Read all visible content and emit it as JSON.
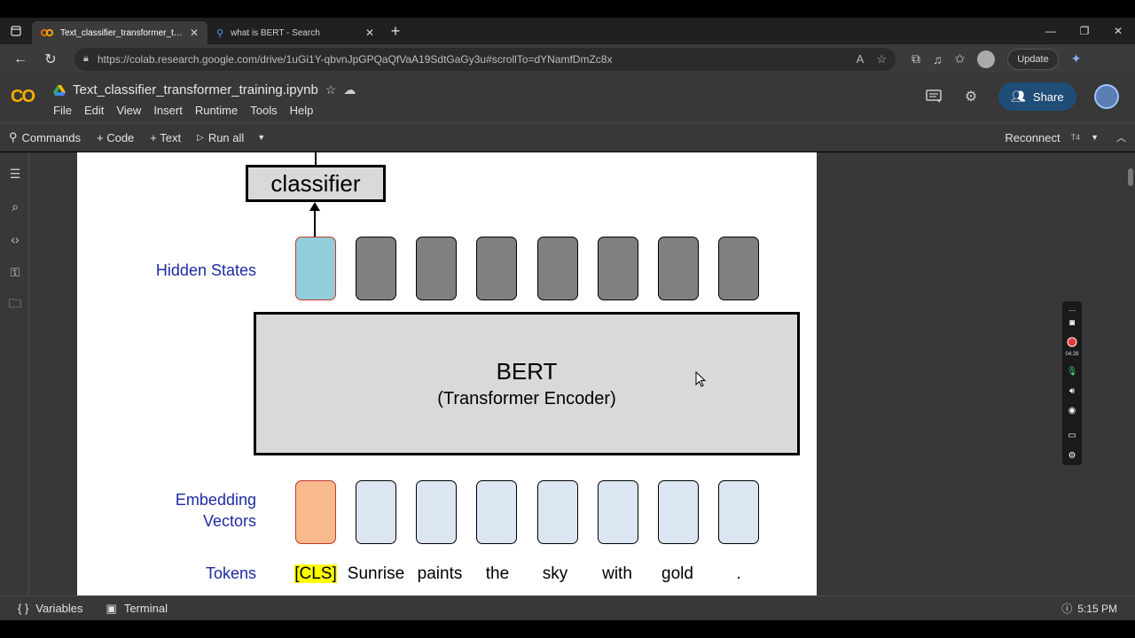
{
  "browser": {
    "tabs": [
      {
        "title": "Text_classifier_transformer_training",
        "active": true
      },
      {
        "title": "what is BERT - Search",
        "active": false
      }
    ],
    "url": "https://colab.research.google.com/drive/1uGi1Y-qbvnJpGPQaQfVaA19SdtGaGy3u#scrollTo=dYNamfDmZc8x",
    "update_label": "Update"
  },
  "colab": {
    "logo": "CO",
    "notebook_title": "Text_classifier_transformer_training.ipynb",
    "menu": [
      "File",
      "Edit",
      "View",
      "Insert",
      "Runtime",
      "Tools",
      "Help"
    ],
    "share_label": "Share"
  },
  "toolbar": {
    "commands_label": "Commands",
    "code_label": "+ Code",
    "text_label": "+ Text",
    "run_all_label": "Run all",
    "reconnect_label": "Reconnect",
    "runtime_type": "T4"
  },
  "figure": {
    "classifier_label": "classifier",
    "hidden_states_label": "Hidden States",
    "bert_title": "BERT",
    "bert_subtitle": "(Transformer Encoder)",
    "embedding_label_line1": "Embedding",
    "embedding_label_line2": "Vectors",
    "tokens_label": "Tokens",
    "tokens": [
      "[CLS]",
      "Sunrise",
      "paints",
      "the",
      "sky",
      "with",
      "gold",
      "."
    ]
  },
  "recorder": {
    "time": "04:28"
  },
  "statusbar": {
    "variables_label": "Variables",
    "terminal_label": "Terminal",
    "time": "5:15 PM"
  }
}
